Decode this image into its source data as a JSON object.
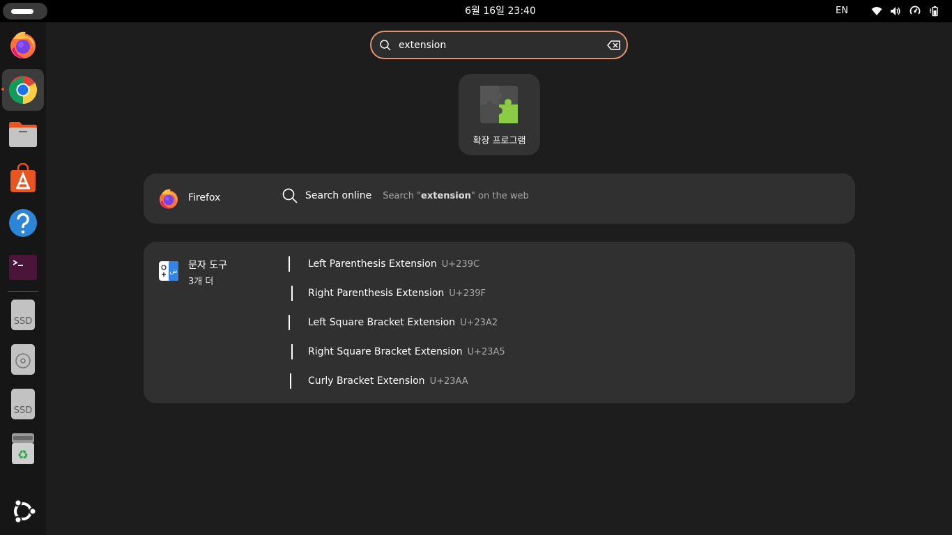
{
  "topbar": {
    "clock": "6월 16일  23:40",
    "input_language": "EN",
    "tray_icons": [
      "wifi-icon",
      "volume-icon",
      "power-profile-icon",
      "battery-icon"
    ]
  },
  "dock": {
    "apps": [
      {
        "name": "firefox",
        "icon": "firefox-icon"
      },
      {
        "name": "chrome",
        "icon": "chrome-icon",
        "active": true
      },
      {
        "name": "files",
        "icon": "files-icon"
      },
      {
        "name": "app-center",
        "icon": "app-center-icon"
      },
      {
        "name": "help",
        "icon": "help-icon"
      },
      {
        "name": "terminal",
        "icon": "terminal-icon"
      }
    ],
    "drives": [
      {
        "name": "ssd-drive-1",
        "label": "SSD"
      },
      {
        "name": "optical-drive",
        "label": ""
      },
      {
        "name": "ssd-drive-2",
        "label": "SSD"
      },
      {
        "name": "trash",
        "label": ""
      }
    ],
    "show_apps_icon": "ubuntu-logo-icon"
  },
  "search": {
    "value": "extension"
  },
  "app_results": [
    {
      "label": "확장 프로그램",
      "icon": "puzzle-piece-icon"
    }
  ],
  "providers": {
    "firefox": {
      "name": "Firefox",
      "result_title": "Search online",
      "result_desc_prefix": "Search \"",
      "result_desc_term": "extension",
      "result_desc_suffix": "\" on the web"
    },
    "characters": {
      "name": "문자 도구",
      "more": "3개 더",
      "results": [
        {
          "name": "Left Parenthesis Extension",
          "code": "U+239C"
        },
        {
          "name": "Right Parenthesis Extension",
          "code": "U+239F"
        },
        {
          "name": "Left Square Bracket Extension",
          "code": "U+23A2"
        },
        {
          "name": "Right Square Bracket Extension",
          "code": "U+23A5"
        },
        {
          "name": "Curly Bracket Extension",
          "code": "U+23AA"
        }
      ]
    }
  },
  "colors": {
    "accent": "#e95420",
    "search_border": "#e1916b",
    "card_bg": "#303030",
    "background": "#1d1d1d"
  }
}
